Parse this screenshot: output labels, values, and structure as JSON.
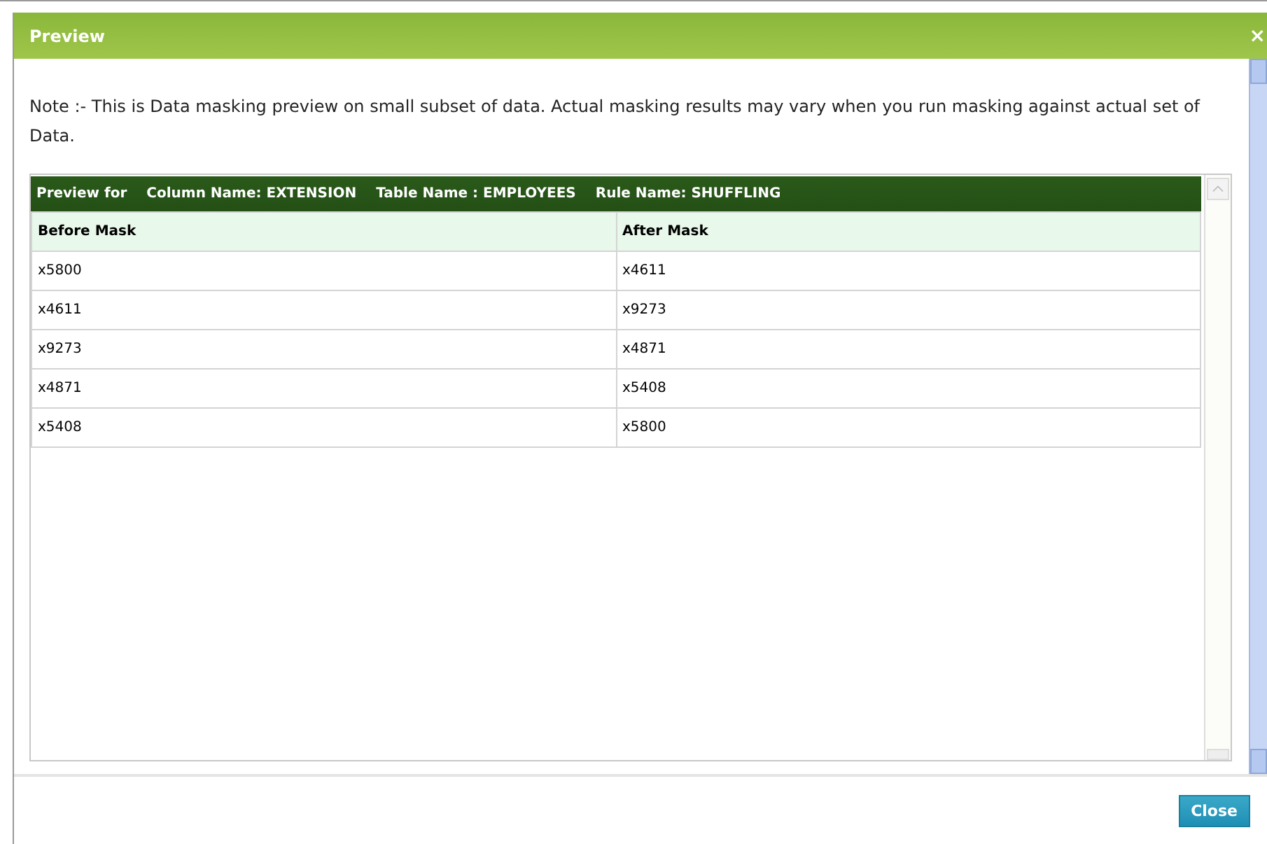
{
  "window": {
    "title": "Preview",
    "close_glyph": "×"
  },
  "note": "Note :- This is Data masking preview on small subset of data. Actual masking results may vary when you run masking against actual set of Data.",
  "grid": {
    "caption": [
      "Preview for",
      "Column Name: EXTENSION",
      "Table Name : EMPLOYEES",
      "Rule Name: SHUFFLING"
    ],
    "columns": [
      "Before Mask",
      "After Mask"
    ],
    "rows": [
      [
        "x5800",
        "x4611"
      ],
      [
        "x4611",
        "x9273"
      ],
      [
        "x9273",
        "x4871"
      ],
      [
        "x4871",
        "x5408"
      ],
      [
        "x5408",
        "x5800"
      ]
    ]
  },
  "buttons": [
    "Close"
  ]
}
